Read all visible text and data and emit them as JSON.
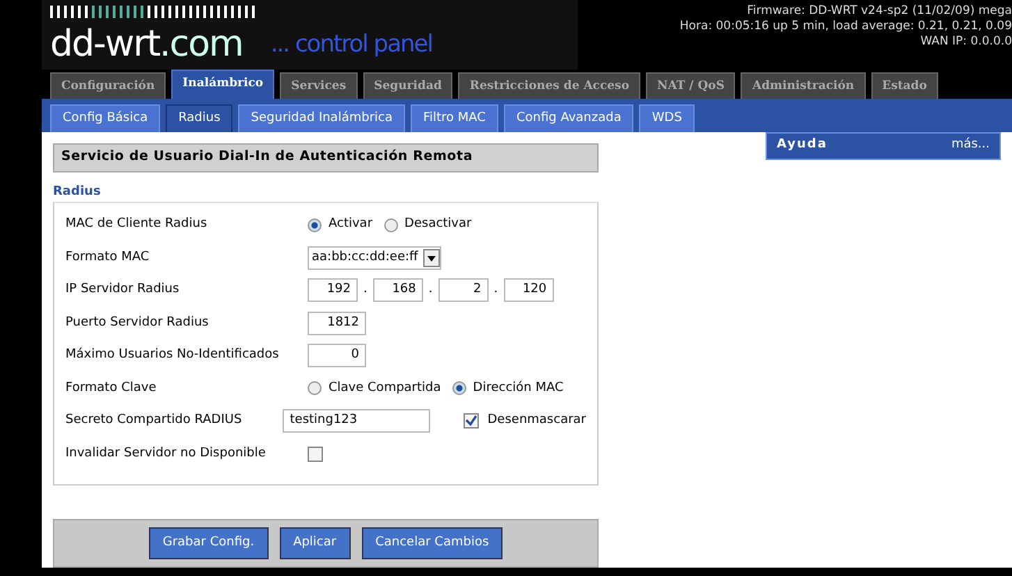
{
  "header": {
    "logo": "dd-wrt",
    "logo_suffix": ".com",
    "subtitle": "... control panel",
    "info": [
      "Firmware: DD-WRT v24-sp2 (11/02/09) mega",
      "Hora: 00:05:16 up 5 min, load average: 0.21, 0.21, 0.09",
      "WAN IP: 0.0.0.0"
    ]
  },
  "tabs": [
    {
      "label": "Configuración",
      "selected": false
    },
    {
      "label": "Inalámbrico",
      "selected": true
    },
    {
      "label": "Services",
      "selected": false
    },
    {
      "label": "Seguridad",
      "selected": false
    },
    {
      "label": "Restricciones de Acceso",
      "selected": false
    },
    {
      "label": "NAT / QoS",
      "selected": false
    },
    {
      "label": "Administración",
      "selected": false
    },
    {
      "label": "Estado",
      "selected": false
    }
  ],
  "subtabs": [
    {
      "label": "Config Básica",
      "selected": false
    },
    {
      "label": "Radius",
      "selected": true
    },
    {
      "label": "Seguridad Inalámbrica",
      "selected": false
    },
    {
      "label": "Filtro MAC",
      "selected": false
    },
    {
      "label": "Config Avanzada",
      "selected": false
    },
    {
      "label": "WDS",
      "selected": false
    }
  ],
  "section_title": "Servicio de Usuario Dial-In de Autenticación Remota",
  "fieldset": {
    "legend": "Radius",
    "fields": [
      {
        "kind": "radio",
        "label": "MAC de Cliente Radius",
        "options": [
          {
            "label": "Activar",
            "selected": true
          },
          {
            "label": "Desactivar",
            "selected": false
          }
        ]
      },
      {
        "kind": "select",
        "label": "Formato MAC",
        "value": "aa:bb:cc:dd:ee:ff"
      },
      {
        "kind": "ip",
        "label": "IP Servidor Radius",
        "octets": [
          "192",
          "168",
          "2",
          "120"
        ],
        "separator": "."
      },
      {
        "kind": "number",
        "label": "Puerto Servidor Radius",
        "value": "1812"
      },
      {
        "kind": "number",
        "label": "Máximo Usuarios No-Identificados",
        "value": "0"
      },
      {
        "kind": "radio",
        "label": "Formato Clave",
        "options": [
          {
            "label": "Clave Compartida",
            "selected": false
          },
          {
            "label": "Dirección MAC",
            "selected": true
          }
        ]
      },
      {
        "kind": "secret",
        "label": "Secreto Compartido RADIUS",
        "value": "testing123",
        "unmask_label": "Desenmascarar",
        "checked": true
      },
      {
        "kind": "checkbox",
        "label": "Invalidar Servidor no Disponible",
        "checked": false
      }
    ]
  },
  "buttons": [
    "Grabar Config.",
    "Aplicar",
    "Cancelar Cambios"
  ],
  "help": {
    "title": "Ayuda",
    "more": "más..."
  }
}
